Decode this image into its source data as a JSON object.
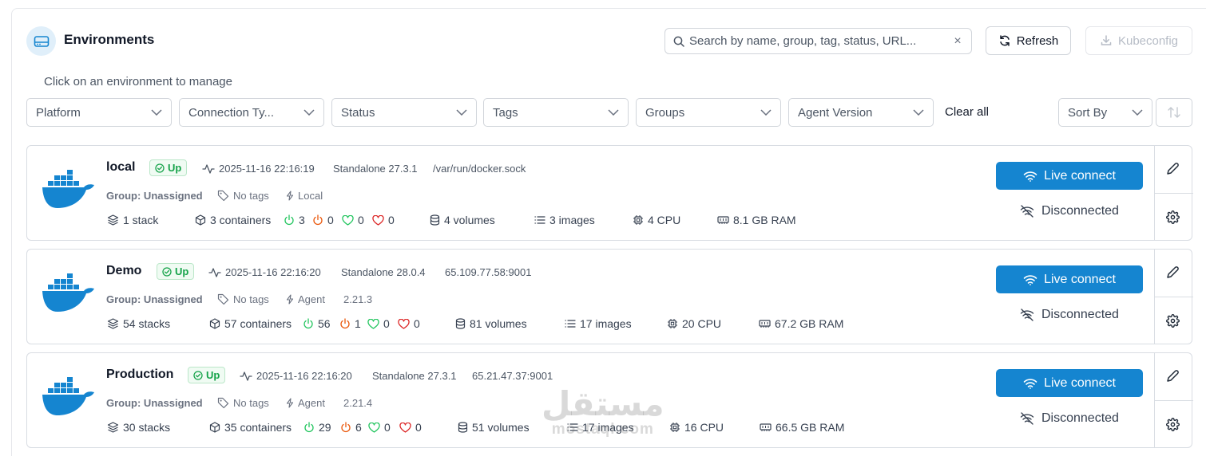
{
  "header": {
    "title": "Environments",
    "subtitle": "Click on an environment to manage",
    "icon": "server-drive-icon",
    "accent_color": "#1585d0"
  },
  "search": {
    "placeholder": "Search by name, group, tag, status, URL...",
    "value": ""
  },
  "toolbar": {
    "refresh_label": "Refresh",
    "kubeconfig_label": "Kubeconfig"
  },
  "filters": {
    "platform": "Platform",
    "connection_type": "Connection Ty...",
    "status": "Status",
    "tags": "Tags",
    "groups": "Groups",
    "agent_version": "Agent Version",
    "clear_all": "Clear all",
    "sort_by": "Sort By"
  },
  "environments": [
    {
      "name": "local",
      "status": "Up",
      "timestamp": "2025-11-16 22:16:19",
      "engine": "Standalone 27.3.1",
      "url": "/var/run/docker.sock",
      "group": "Group: Unassigned",
      "tags": "No tags",
      "type": "Local",
      "agent_version": "",
      "stacks": "1 stack",
      "containers": "3 containers",
      "running": "3",
      "stopped": "0",
      "healthy": "0",
      "unhealthy": "0",
      "volumes": "4 volumes",
      "images": "3 images",
      "cpu": "4 CPU",
      "ram": "8.1 GB RAM",
      "live_label": "Live connect",
      "connection_state": "Disconnected"
    },
    {
      "name": "Demo",
      "status": "Up",
      "timestamp": "2025-11-16 22:16:20",
      "engine": "Standalone 28.0.4",
      "url": "65.109.77.58:9001",
      "group": "Group: Unassigned",
      "tags": "No tags",
      "type": "Agent",
      "agent_version": "2.21.3",
      "stacks": "54 stacks",
      "containers": "57 containers",
      "running": "56",
      "stopped": "1",
      "healthy": "0",
      "unhealthy": "0",
      "volumes": "81 volumes",
      "images": "17 images",
      "cpu": "20 CPU",
      "ram": "67.2 GB RAM",
      "live_label": "Live connect",
      "connection_state": "Disconnected"
    },
    {
      "name": "Production",
      "status": "Up",
      "timestamp": "2025-11-16 22:16:20",
      "engine": "Standalone 27.3.1",
      "url": "65.21.47.37:9001",
      "group": "Group: Unassigned",
      "tags": "No tags",
      "type": "Agent",
      "agent_version": "2.21.4",
      "stacks": "30 stacks",
      "containers": "35 containers",
      "running": "29",
      "stopped": "6",
      "healthy": "0",
      "unhealthy": "0",
      "volumes": "51 volumes",
      "images": "17 images",
      "cpu": "16 CPU",
      "ram": "66.5 GB RAM",
      "live_label": "Live connect",
      "connection_state": "Disconnected"
    }
  ],
  "watermark": {
    "arabic": "مستقل",
    "latin": "mostaql.com"
  }
}
